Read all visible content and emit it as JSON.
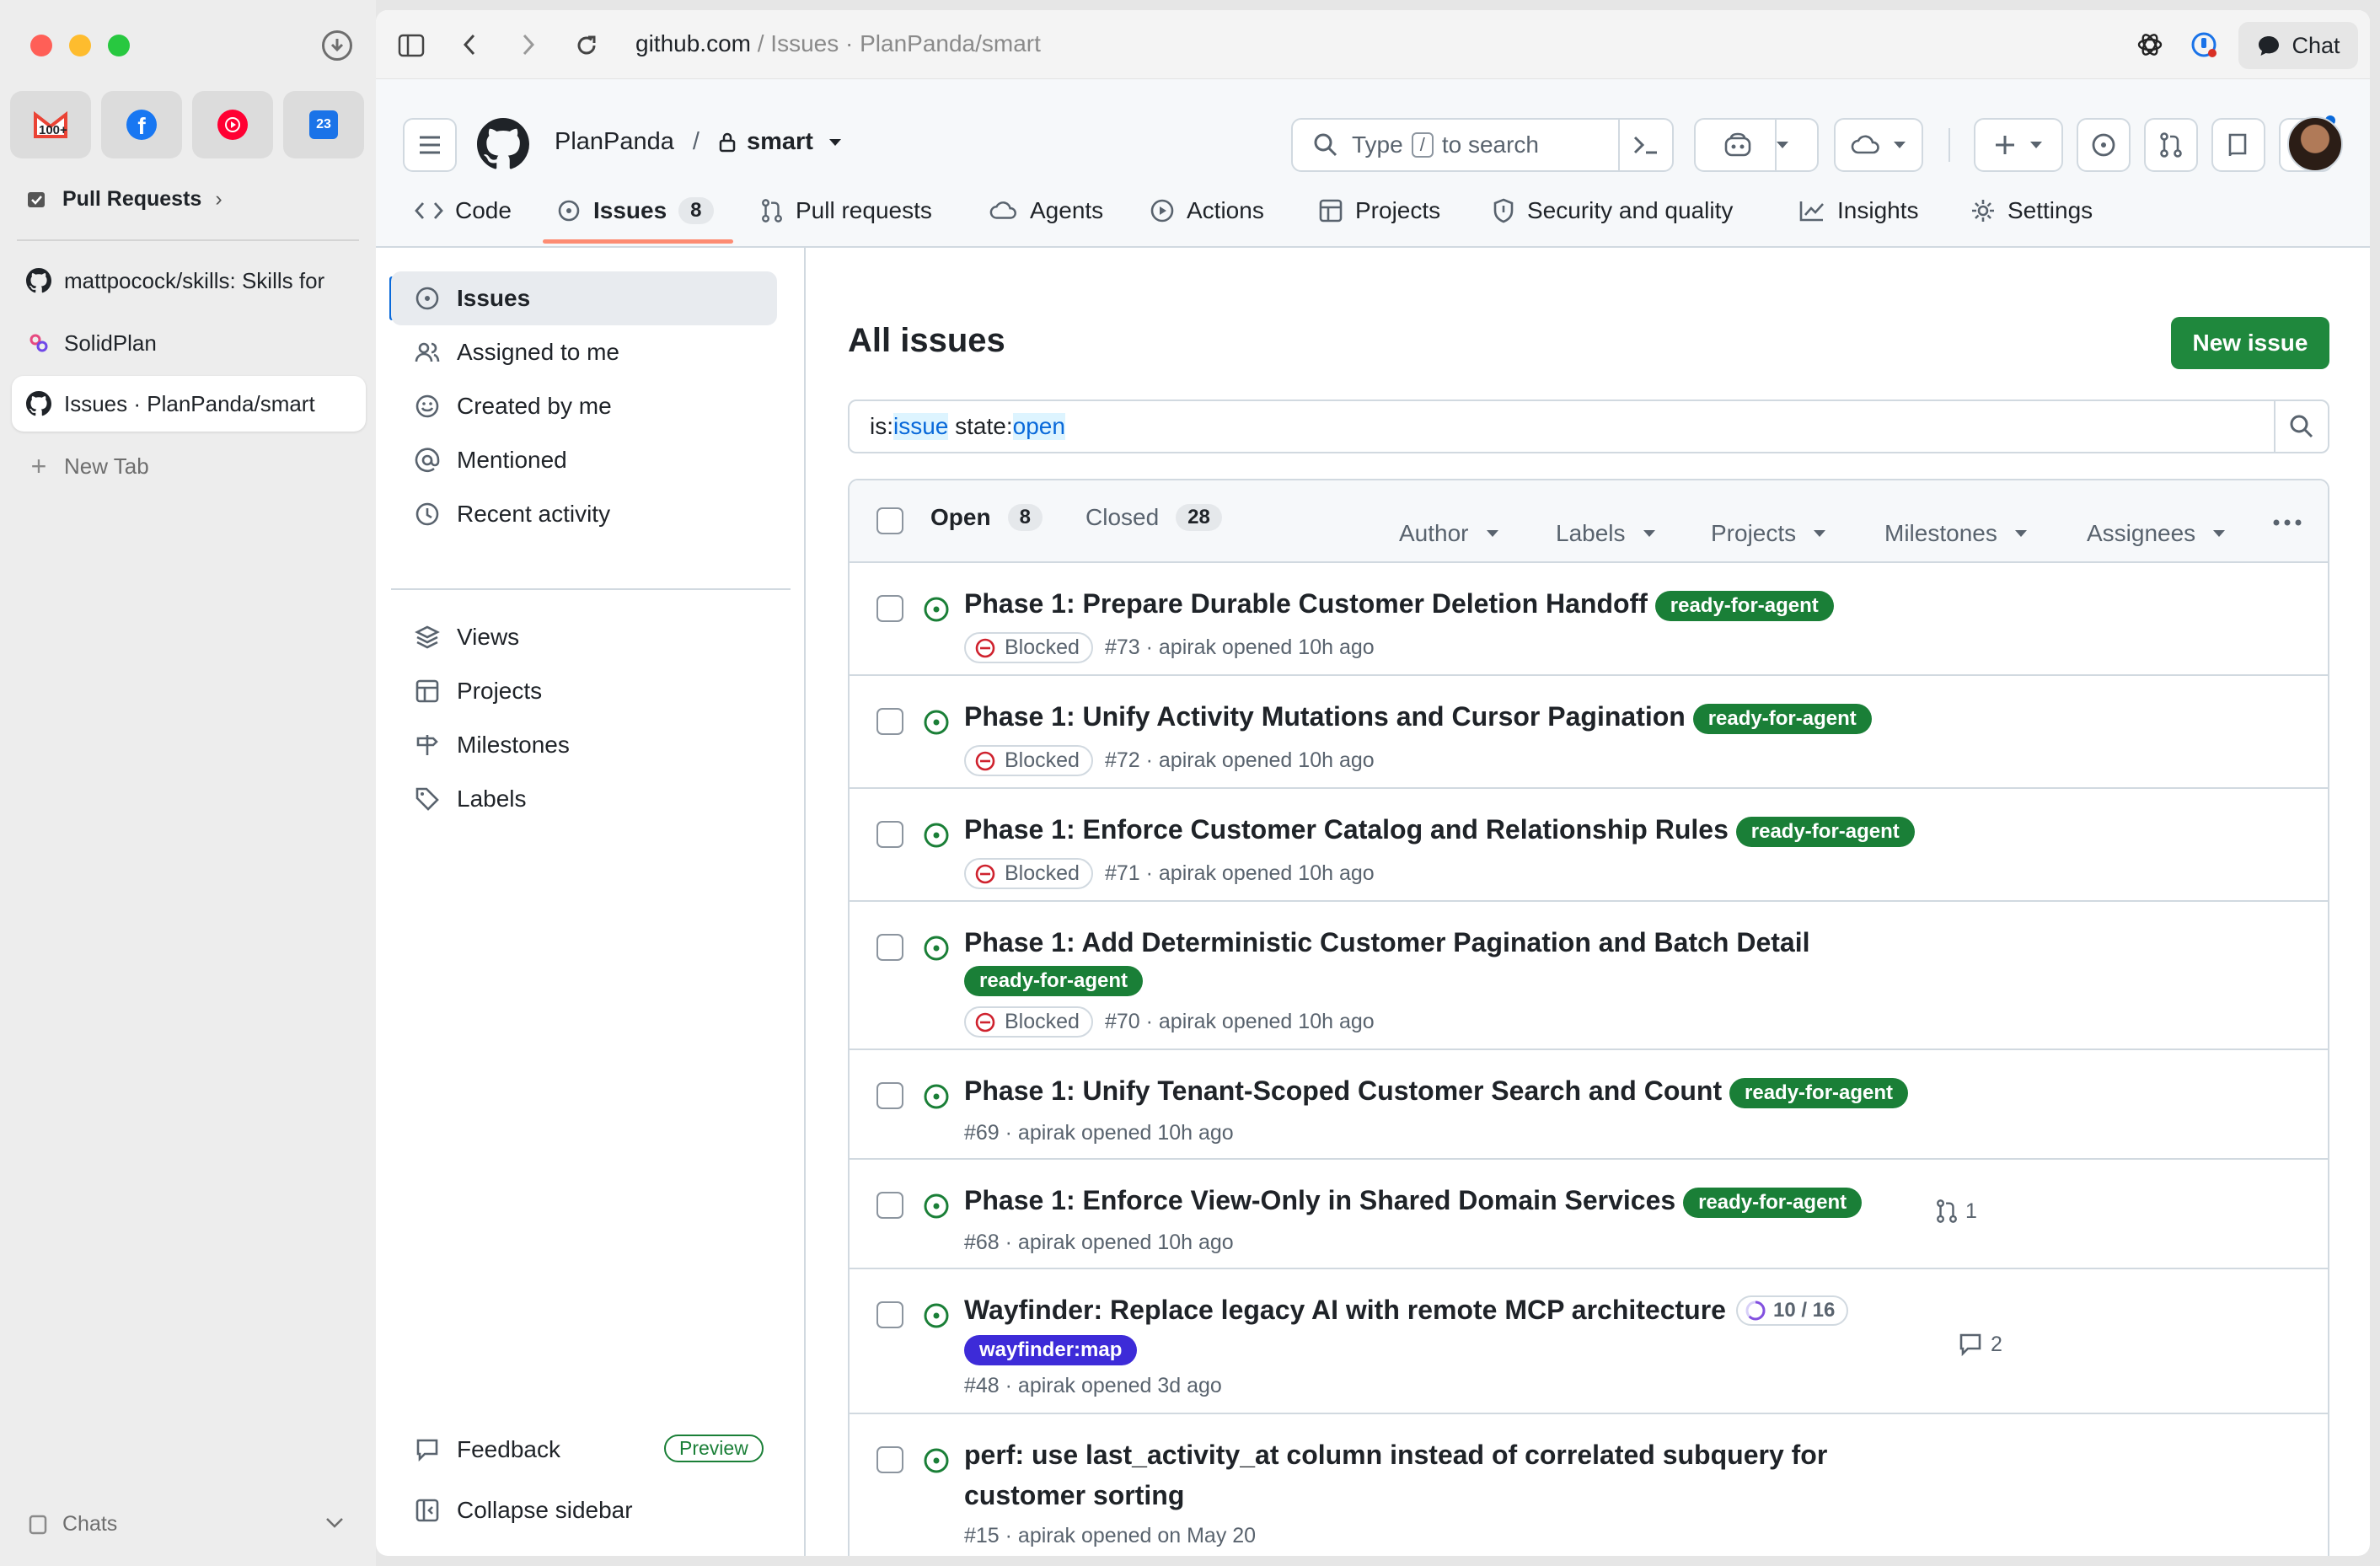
{
  "browser": {
    "pinned": [
      {
        "name": "gmail",
        "badge": "100+",
        "color": "#ea4335"
      },
      {
        "name": "facebook",
        "color": "#1877f2"
      },
      {
        "name": "youtube-music",
        "color": "#ff0033"
      },
      {
        "name": "calendar",
        "badge": "23",
        "color": "#1a73e8"
      }
    ],
    "folder_label": "Pull Requests",
    "tabs": [
      {
        "label": "mattpocock/skills: Skills for"
      },
      {
        "label": "SolidPlan"
      },
      {
        "label": "Issues · PlanPanda/smart",
        "active": true
      }
    ],
    "new_tab_label": "New Tab",
    "chats_label": "Chats",
    "url_host": "github.com",
    "url_rest": " / Issues · PlanPanda/smart",
    "chat_label": "Chat"
  },
  "repo": {
    "owner": "PlanPanda",
    "separator": "/",
    "name": "smart",
    "search_placeholder_prefix": "Type",
    "search_key": "/",
    "search_placeholder_suffix": "to search"
  },
  "tabs": [
    {
      "label": "Code"
    },
    {
      "label": "Issues",
      "count": "8"
    },
    {
      "label": "Pull requests"
    },
    {
      "label": "Agents"
    },
    {
      "label": "Actions"
    },
    {
      "label": "Projects"
    },
    {
      "label": "Security and quality"
    },
    {
      "label": "Insights"
    },
    {
      "label": "Settings"
    }
  ],
  "nav": {
    "items": [
      "Issues",
      "Assigned to me",
      "Created by me",
      "Mentioned",
      "Recent activity"
    ],
    "secondary": [
      "Views",
      "Projects",
      "Milestones",
      "Labels"
    ],
    "feedback": "Feedback",
    "preview": "Preview",
    "collapse": "Collapse sidebar"
  },
  "main": {
    "title": "All issues",
    "new_issue": "New issue",
    "query": {
      "k1": "is:",
      "v1": "issue",
      "k2": " state:",
      "v2": "open"
    },
    "open_label": "Open",
    "open_count": "8",
    "closed_label": "Closed",
    "closed_count": "28",
    "filters": [
      "Author",
      "Labels",
      "Projects",
      "Milestones",
      "Assignees"
    ]
  },
  "issues": [
    {
      "title": "Phase 1: Prepare Durable Customer Deletion Handoff",
      "label": "ready-for-agent",
      "blocked": "Blocked",
      "meta": "#73 · apirak opened 10h ago"
    },
    {
      "title": "Phase 1: Unify Activity Mutations and Cursor Pagination",
      "label": "ready-for-agent",
      "blocked": "Blocked",
      "meta": "#72 · apirak opened 10h ago"
    },
    {
      "title": "Phase 1: Enforce Customer Catalog and Relationship Rules",
      "label": "ready-for-agent",
      "blocked": "Blocked",
      "meta": "#71 · apirak opened 10h ago"
    },
    {
      "title": "Phase 1: Add Deterministic Customer Pagination and Batch Detail",
      "label": "ready-for-agent",
      "blocked": "Blocked",
      "meta": "#70 · apirak opened 10h ago"
    },
    {
      "title": "Phase 1: Unify Tenant-Scoped Customer Search and Count",
      "label": "ready-for-agent",
      "meta": "#69 · apirak opened 10h ago"
    },
    {
      "title": "Phase 1: Enforce View-Only in Shared Domain Services",
      "label": "ready-for-agent",
      "meta": "#68 · apirak opened 10h ago",
      "prs": "1"
    },
    {
      "title": "Wayfinder: Replace legacy AI with remote MCP architecture",
      "progress": "10 / 16",
      "progress_fraction": 0.625,
      "label": "wayfinder:map",
      "meta": "#48 · apirak opened 3d ago",
      "comments": "2"
    },
    {
      "title_l1": "perf: use last_activity_at column instead of correlated subquery for",
      "title_l2": "customer sorting",
      "meta": "#15 · apirak opened on May 20"
    }
  ]
}
